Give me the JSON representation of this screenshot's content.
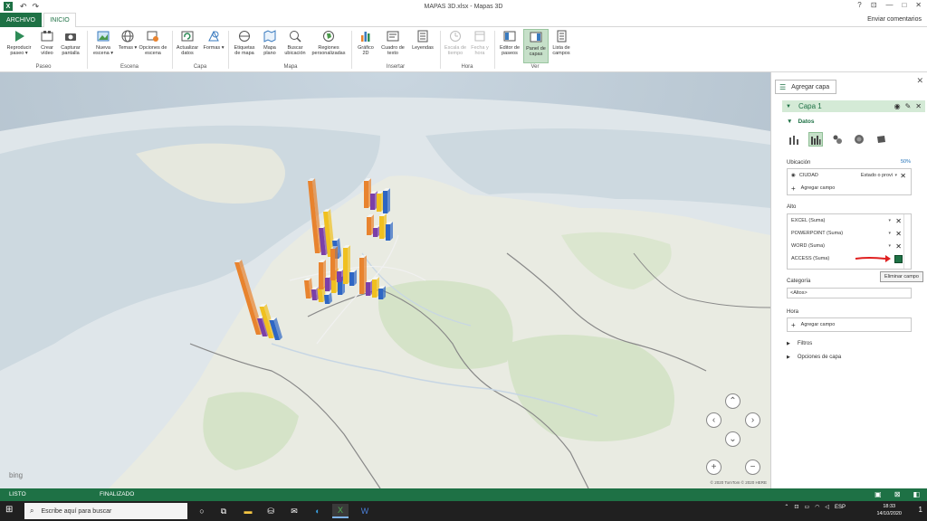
{
  "titlebar": {
    "title": "MAPAS 3D.xlsx - Mapas 3D",
    "app_icon": "X",
    "undo": "↶",
    "redo": "↷",
    "help": "?",
    "restore_icon": "⊡",
    "minimize": "—",
    "maximize": "□",
    "close": "✕"
  },
  "tabs": {
    "archivo": "ARCHIVO",
    "inicio": "INICIO",
    "feedback": "Enviar comentarios"
  },
  "ribbon": {
    "buttons": [
      {
        "label": "Reproducir paseo ▾",
        "icon": "play-icon"
      },
      {
        "label": "Crear vídeo",
        "icon": "video-icon"
      },
      {
        "label": "Capturar pantalla",
        "icon": "camera-icon"
      },
      {
        "label": "Nueva escena ▾",
        "icon": "new-scene-icon"
      },
      {
        "label": "Temas ▾",
        "icon": "globe-icon"
      },
      {
        "label": "Opciones de escena",
        "icon": "scene-options-icon"
      },
      {
        "label": "Actualizar datos",
        "icon": "refresh-icon"
      },
      {
        "label": "Formas ▾",
        "icon": "shapes-icon"
      },
      {
        "label": "Etiquetas de mapa",
        "icon": "map-labels-icon"
      },
      {
        "label": "Mapa plano",
        "icon": "flat-map-icon"
      },
      {
        "label": "Buscar ubicación",
        "icon": "find-location-icon"
      },
      {
        "label": "Regiones personalizadas",
        "icon": "regions-icon"
      },
      {
        "label": "Gráfico 2D",
        "icon": "chart-2d-icon"
      },
      {
        "label": "Cuadro de texto",
        "icon": "textbox-icon"
      },
      {
        "label": "Leyendas",
        "icon": "legend-icon"
      },
      {
        "label": "Escala de tiempo",
        "icon": "timeline-icon"
      },
      {
        "label": "Fecha y hora",
        "icon": "datetime-icon"
      },
      {
        "label": "Editor de paseos",
        "icon": "tour-editor-icon"
      },
      {
        "label": "Panel de capas",
        "icon": "layer-pane-icon"
      },
      {
        "label": "Lista de campos",
        "icon": "field-list-icon"
      }
    ],
    "groups": [
      "Paseo",
      "Escena",
      "Capa",
      "Mapa",
      "Insertar",
      "Hora",
      "Ver"
    ]
  },
  "map": {
    "copyright": "© 2020 TomTom © 2020 HERE",
    "bing": "bing",
    "colors": {
      "excel": "#e8832e",
      "powerpoint": "#7b3fa8",
      "word": "#f0c020",
      "access": "#2e66c4"
    }
  },
  "panel": {
    "add_layer": "Agregar capa",
    "close": "✕",
    "layer_name": "Capa 1",
    "datos": "Datos",
    "ubicacion_label": "Ubicación",
    "ubicacion_pct": "50%",
    "location_field": {
      "name": "CIUDAD",
      "type": "Estado o provi"
    },
    "add_field": "Agregar campo",
    "alto_label": "Alto",
    "alto_fields": [
      "EXCEL (Suma)",
      "POWERPOINT (Suma)",
      "WORD (Suma)",
      "ACCESS (Suma)"
    ],
    "categoria_label": "Categoría",
    "categoria_value": "<Altos>",
    "hora_label": "Hora",
    "filtros": "Filtros",
    "opciones_capa": "Opciones de capa",
    "tooltip": "Eliminar campo"
  },
  "status": {
    "left": "LISTO",
    "mid": "FINALIZADO"
  },
  "taskbar": {
    "search_placeholder": "Escribe aquí para buscar",
    "lang": "ESP",
    "time": "18:33",
    "date": "14/10/2020",
    "notif_count": "1"
  }
}
